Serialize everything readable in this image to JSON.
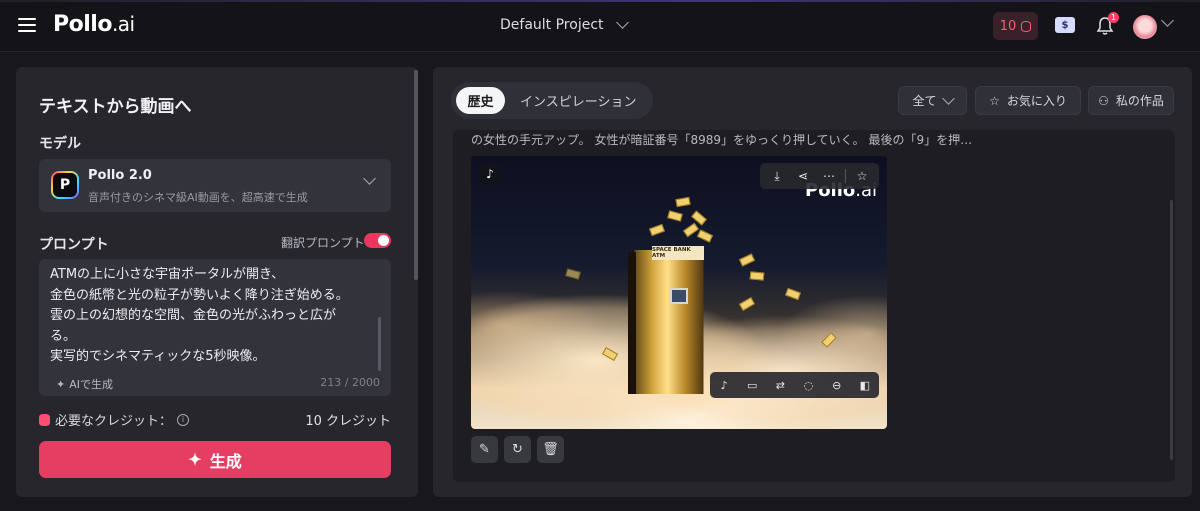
{
  "header": {
    "logo_main": "Pollo",
    "logo_suffix": ".ai",
    "project_name": "Default Project",
    "credits": "10",
    "notification_count": "1"
  },
  "left": {
    "title": "テキストから動画へ",
    "model_label": "モデル",
    "model": {
      "logo_letter": "P",
      "name": "Pollo 2.0",
      "description": "音声付きのシネマ級AI動画を、超高速で生成"
    },
    "prompt_label": "プロンプト",
    "translate_label": "翻訳プロンプト",
    "prompt_text": "ATMの上に小さな宇宙ポータルが開き、\n金色の紙幣と光の粒子が勢いよく降り注ぎ始める。\n雲の上の幻想的な空間、金色の光がふわっと広が\nる。\n実写的でシネマティックな5秒映像。",
    "ai_generate": "AIで生成",
    "char_count": "213 / 2000",
    "required_credits_label": "必要なクレジット：",
    "credit_value": "10 クレジット",
    "generate_button": "生成"
  },
  "right": {
    "tabs": [
      {
        "label": "歴史"
      },
      {
        "label": "インスピレーション"
      }
    ],
    "filter_all": "全て",
    "favorites": "お気に入り",
    "my_works": "私の作品",
    "caption": "の女性の手元アップ。 女性が暗証番号「8989」をゆっくり押していく。 最後の「9」を押…",
    "video": {
      "atm_sign": "SPACE BANK ATM",
      "watermark_main": "Pollo",
      "watermark_suffix": ".ai"
    }
  },
  "colors": {
    "accent": "#e63e63",
    "panel": "#26262c",
    "background": "#18181c"
  }
}
